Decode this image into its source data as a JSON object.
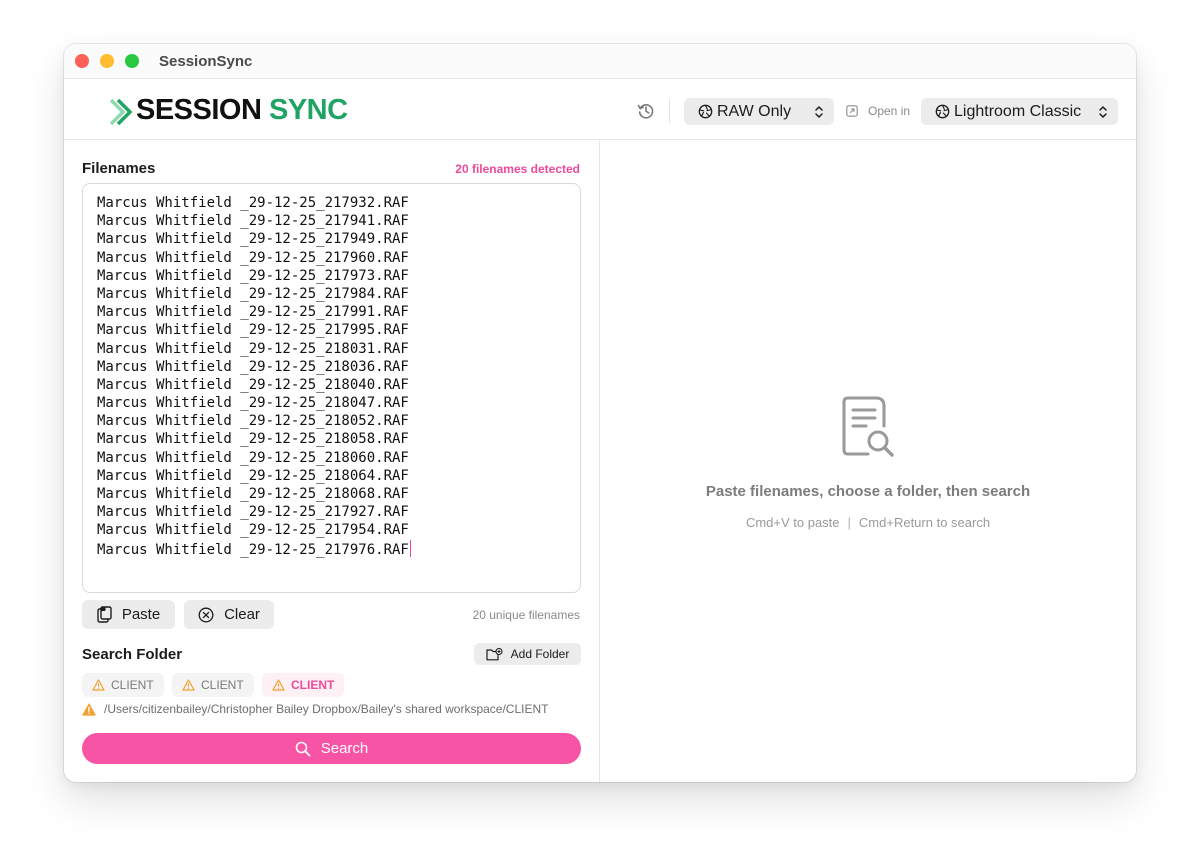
{
  "window": {
    "title": "SessionSync"
  },
  "brand": {
    "logo_part1": "SESSION",
    "logo_part2": "SYNC",
    "accent_color": "#f754a5",
    "logo_green": "#1fa463"
  },
  "toolbar": {
    "history_icon": "history-icon",
    "file_filter": "RAW Only",
    "open_in_label": "Open in",
    "open_in_app": "Lightroom Classic"
  },
  "filenames": {
    "title": "Filenames",
    "detected": "20 filenames detected",
    "lines": [
      "Marcus Whitfield _29-12-25_217932.RAF",
      "Marcus Whitfield _29-12-25_217941.RAF",
      "Marcus Whitfield _29-12-25_217949.RAF",
      "Marcus Whitfield _29-12-25_217960.RAF",
      "Marcus Whitfield _29-12-25_217973.RAF",
      "Marcus Whitfield _29-12-25_217984.RAF",
      "Marcus Whitfield _29-12-25_217991.RAF",
      "Marcus Whitfield _29-12-25_217995.RAF",
      "Marcus Whitfield _29-12-25_218031.RAF",
      "Marcus Whitfield _29-12-25_218036.RAF",
      "Marcus Whitfield _29-12-25_218040.RAF",
      "Marcus Whitfield _29-12-25_218047.RAF",
      "Marcus Whitfield _29-12-25_218052.RAF",
      "Marcus Whitfield _29-12-25_218058.RAF",
      "Marcus Whitfield _29-12-25_218060.RAF",
      "Marcus Whitfield _29-12-25_218064.RAF",
      "Marcus Whitfield _29-12-25_218068.RAF",
      "Marcus Whitfield _29-12-25_217927.RAF",
      "Marcus Whitfield _29-12-25_217954.RAF",
      "Marcus Whitfield _29-12-25_217976.RAF"
    ],
    "paste_label": "Paste",
    "clear_label": "Clear",
    "unique_count": "20 unique filenames"
  },
  "search_folder": {
    "title": "Search Folder",
    "add_folder_label": "Add Folder",
    "chips": [
      {
        "label": "CLIENT",
        "active": false
      },
      {
        "label": "CLIENT",
        "active": false
      },
      {
        "label": "CLIENT",
        "active": true
      }
    ],
    "path": "/Users/citizenbailey/Christopher Bailey Dropbox/Bailey's shared workspace/CLIENT",
    "warning_color": "#f0a030"
  },
  "search_button": {
    "label": "Search"
  },
  "empty_state": {
    "icon": "document-search-icon",
    "title": "Paste filenames, choose a folder, then search",
    "hint_paste": "Cmd+V to paste",
    "hint_separator": "|",
    "hint_search": "Cmd+Return to search"
  }
}
